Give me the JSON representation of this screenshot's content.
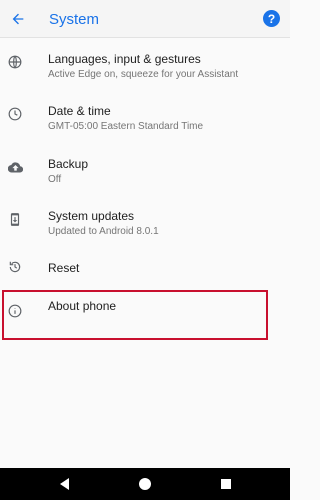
{
  "appbar": {
    "title": "System",
    "back_icon": "arrow-back-icon",
    "help_icon": "help-icon",
    "help_glyph": "?",
    "accent_color": "#1a73e8"
  },
  "items": [
    {
      "icon": "globe-icon",
      "label": "Languages, input & gestures",
      "sub": "Active Edge on, squeeze for your Assistant"
    },
    {
      "icon": "clock-icon",
      "label": "Date & time",
      "sub": "GMT-05:00 Eastern Standard Time"
    },
    {
      "icon": "cloud-upload-icon",
      "label": "Backup",
      "sub": "Off"
    },
    {
      "icon": "system-update-icon",
      "label": "System updates",
      "sub": "Updated to Android 8.0.1"
    },
    {
      "icon": "restore-icon",
      "label": "Reset",
      "sub": ""
    },
    {
      "icon": "info-icon",
      "label": "About phone",
      "sub": ""
    }
  ],
  "highlight_color": "#c8102e",
  "navbar": {
    "back": "nav-back-icon",
    "home": "nav-home-icon",
    "recents": "nav-recents-icon"
  }
}
